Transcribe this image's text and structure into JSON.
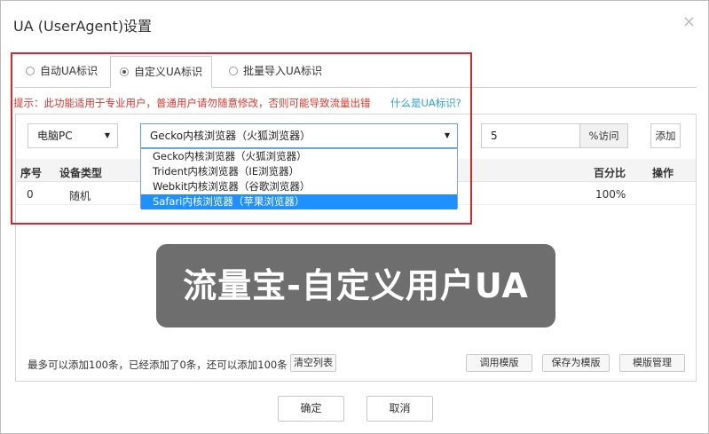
{
  "dialog": {
    "title": "UA (UserAgent)设置",
    "close_icon": "×"
  },
  "tabs": [
    {
      "label": "自动UA标识",
      "active": false
    },
    {
      "label": "自定义UA标识",
      "active": true
    },
    {
      "label": "批量导入UA标识",
      "active": false
    }
  ],
  "hint": {
    "text": "提示：此功能适用于专业用户，普通用户请勿随意修改，否则可能导致流量出错",
    "link": "什么是UA标识?"
  },
  "controls": {
    "device_select": "电脑PC",
    "browser_select": "Gecko内核浏览器（火狐浏览器）",
    "percent_value": "5",
    "percent_suffix": "%访问",
    "add_label": "添加"
  },
  "dropdown": {
    "options": [
      "Gecko内核浏览器（火狐浏览器）",
      "Trident内核浏览器（IE浏览器）",
      "Webkit内核浏览器（谷歌浏览器）",
      "Safari内核浏览器（苹果浏览器）"
    ],
    "highlighted_index": 3
  },
  "table": {
    "headers": {
      "index": "序号",
      "device": "设备类型",
      "percent": "百分比",
      "action": "操作"
    },
    "rows": [
      {
        "index": "0",
        "device": "随机",
        "percent": "100%"
      }
    ]
  },
  "banner": {
    "text": "流量宝-自定义用户UA"
  },
  "footer": {
    "limit_text": "最多可以添加100条，已经添加了0条，还可以添加100条",
    "clear_label": "清空列表",
    "use_template_label": "调用模版",
    "save_template_label": "保存为模版",
    "manage_template_label": "模版管理"
  },
  "buttons": {
    "ok_label": "确定",
    "cancel_label": "取消"
  },
  "colors": {
    "hint_red": "#e0342b",
    "link_blue": "#2aa2d6",
    "highlight_blue": "#1e90ff",
    "annotation_red": "#d9262c"
  }
}
